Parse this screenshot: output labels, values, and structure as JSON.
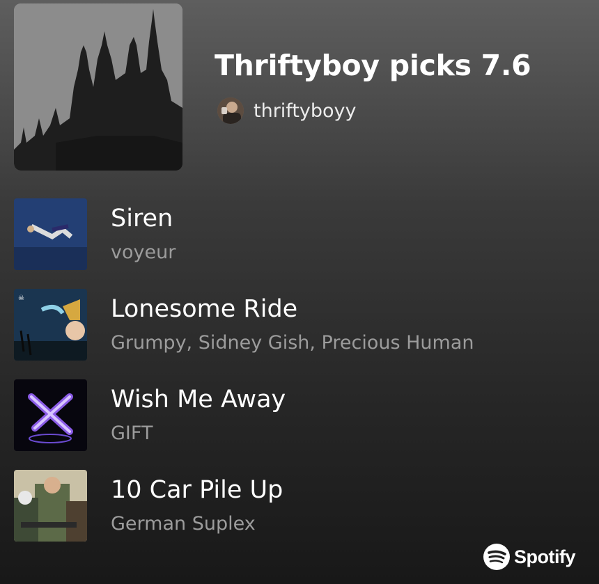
{
  "playlist": {
    "title": "Thriftyboy picks 7.6",
    "owner": "thriftyboyy",
    "cover_icon": "cathedral-silhouette-image",
    "avatar_icon": "user-avatar"
  },
  "tracks": [
    {
      "title": "Siren",
      "artist": "voyeur",
      "art": "album-art-siren"
    },
    {
      "title": "Lonesome Ride",
      "artist": "Grumpy, Sidney Gish, Precious Human",
      "art": "album-art-lonesome-ride"
    },
    {
      "title": "Wish Me Away",
      "artist": "GIFT",
      "art": "album-art-wish-me-away"
    },
    {
      "title": "10 Car Pile Up",
      "artist": "German Suplex",
      "art": "album-art-10-car-pile-up"
    }
  ],
  "branding": {
    "label": "Spotify",
    "icon": "spotify-logo"
  },
  "colors": {
    "background_top": "#5e5e5e",
    "background_bottom": "#181818",
    "secondary_text": "#9c9c9c"
  }
}
